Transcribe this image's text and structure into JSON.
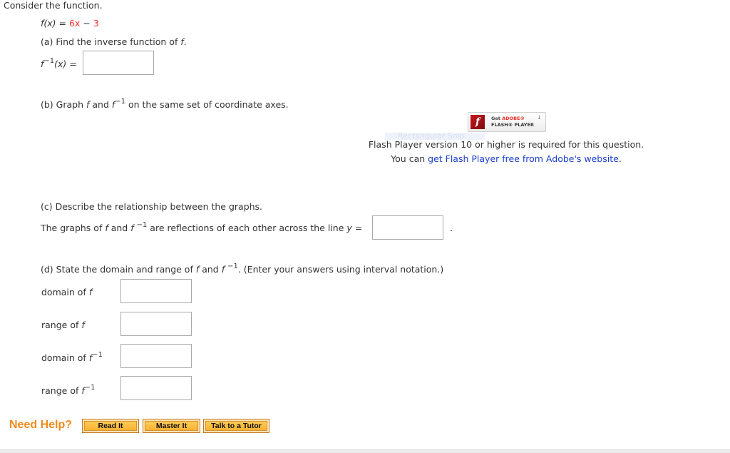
{
  "intro": "Consider the function.",
  "function": {
    "lhs": "f(x)",
    "equals": "=",
    "term1": "6x",
    "minus": "−",
    "term2": "3"
  },
  "part_a": {
    "prompt_prefix": "(a) Find the inverse function of ",
    "prompt_var": "f",
    "prompt_suffix": ".",
    "label_f": "f",
    "label_sup": "−1",
    "label_arg": "(x)",
    "label_eq": "=",
    "answer": ""
  },
  "part_b": {
    "prefix": "(b) Graph ",
    "f": "f",
    "and": " and ",
    "finv": "f",
    "sup": "−1",
    "suffix": " on the same set of coordinate axes."
  },
  "flash": {
    "badge_get": "Get ",
    "badge_adobe": "ADOBE®",
    "badge_line2": "FLASH® PLAYER",
    "logo_glyph": "f",
    "download_icon": "↓",
    "message_line1": "Flash Player version 10 or higher is required for this question.",
    "message_line2_prefix": "You can ",
    "message_link": "get Flash Player free from Adobe's website",
    "message_line2_suffix": ".",
    "ghost_overlay": "Rectangular Snip"
  },
  "part_c": {
    "prompt": "(c) Describe the relationship between the graphs.",
    "sentence_prefix": "The graphs of ",
    "f": "f",
    "and": " and ",
    "finv": "f ",
    "sup": "−1",
    "sentence_mid": " are reflections of each other across the line ",
    "y": "y",
    "eq": " =",
    "answer": "",
    "end": "."
  },
  "part_d": {
    "prefix": "(d) State the domain and range of ",
    "f": "f",
    "and": " and ",
    "finv": "f ",
    "sup": "−1",
    "suffix": ". (Enter your answers using interval notation.)",
    "rows": [
      {
        "label": "domain of ",
        "var": "f",
        "sup": "",
        "answer": ""
      },
      {
        "label": "range of ",
        "var": "f",
        "sup": "",
        "answer": ""
      },
      {
        "label": "domain of ",
        "var": "f",
        "sup": "−1",
        "answer": ""
      },
      {
        "label": "range of ",
        "var": "f",
        "sup": "−1",
        "answer": ""
      }
    ]
  },
  "help": {
    "title": "Need Help?",
    "buttons": [
      "Read It",
      "Master It",
      "Talk to a Tutor"
    ]
  },
  "colors": {
    "accent_red": "#e8322a",
    "link_blue": "#1a3ec9",
    "help_orange": "#f08a1c",
    "button_fill": "#f9b233"
  }
}
